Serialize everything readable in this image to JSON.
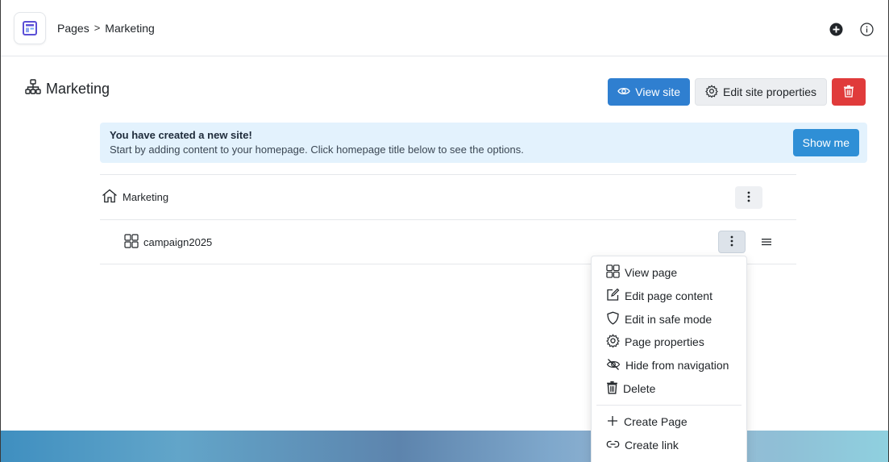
{
  "topbar": {
    "breadcrumb": [
      "Pages",
      "Marketing"
    ],
    "breadcrumb_separator": ">",
    "icons": [
      "logo-icon",
      "add-icon",
      "info-icon"
    ]
  },
  "header": {
    "title": "Marketing",
    "view_site": "View site",
    "edit_site_properties": "Edit site properties"
  },
  "alert": {
    "title": "You have created a new site!",
    "body": "Start by adding content to your homepage. Click homepage title below to see the options.",
    "button": "Show me"
  },
  "tree": {
    "rows": [
      {
        "label": "Marketing",
        "icon": "home-icon"
      },
      {
        "label": "campaign2025",
        "icon": "grid-icon"
      }
    ]
  },
  "dropdown": {
    "group1": [
      {
        "label": "View page",
        "icon": "grid-icon"
      },
      {
        "label": "Edit page content",
        "icon": "edit-icon"
      },
      {
        "label": "Edit in safe mode",
        "icon": "shield-icon"
      },
      {
        "label": "Page properties",
        "icon": "gear-icon"
      },
      {
        "label": "Hide from navigation",
        "icon": "eye-slash-icon"
      },
      {
        "label": "Delete",
        "icon": "trash-icon"
      }
    ],
    "group2": [
      {
        "label": "Create Page",
        "icon": "plus-icon"
      },
      {
        "label": "Create link",
        "icon": "link-icon"
      }
    ]
  },
  "colors": {
    "primary": "#2f7fd0",
    "danger": "#e03b3b",
    "alert_bg": "#e3f2fd",
    "logo_accent": "#5b4fd6"
  }
}
